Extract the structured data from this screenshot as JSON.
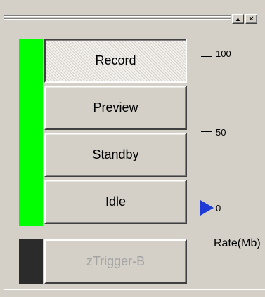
{
  "window": {
    "restore_glyph": "▲",
    "close_glyph": "×"
  },
  "states": [
    {
      "label": "Record"
    },
    {
      "label": "Preview"
    },
    {
      "label": "Standby"
    },
    {
      "label": "Idle"
    }
  ],
  "active_state": "Record",
  "status_color": "#00ff00",
  "trigger": {
    "label": "zTrigger-B",
    "indicator_color": "#2b2b2b",
    "enabled": false
  },
  "rate_scale": {
    "ticks": [
      "100",
      "50",
      "0"
    ],
    "max": 100,
    "min": 0,
    "current_value": 0,
    "pointer_color": "#1f3bd6",
    "unit_label": "Rate(Mb)"
  }
}
